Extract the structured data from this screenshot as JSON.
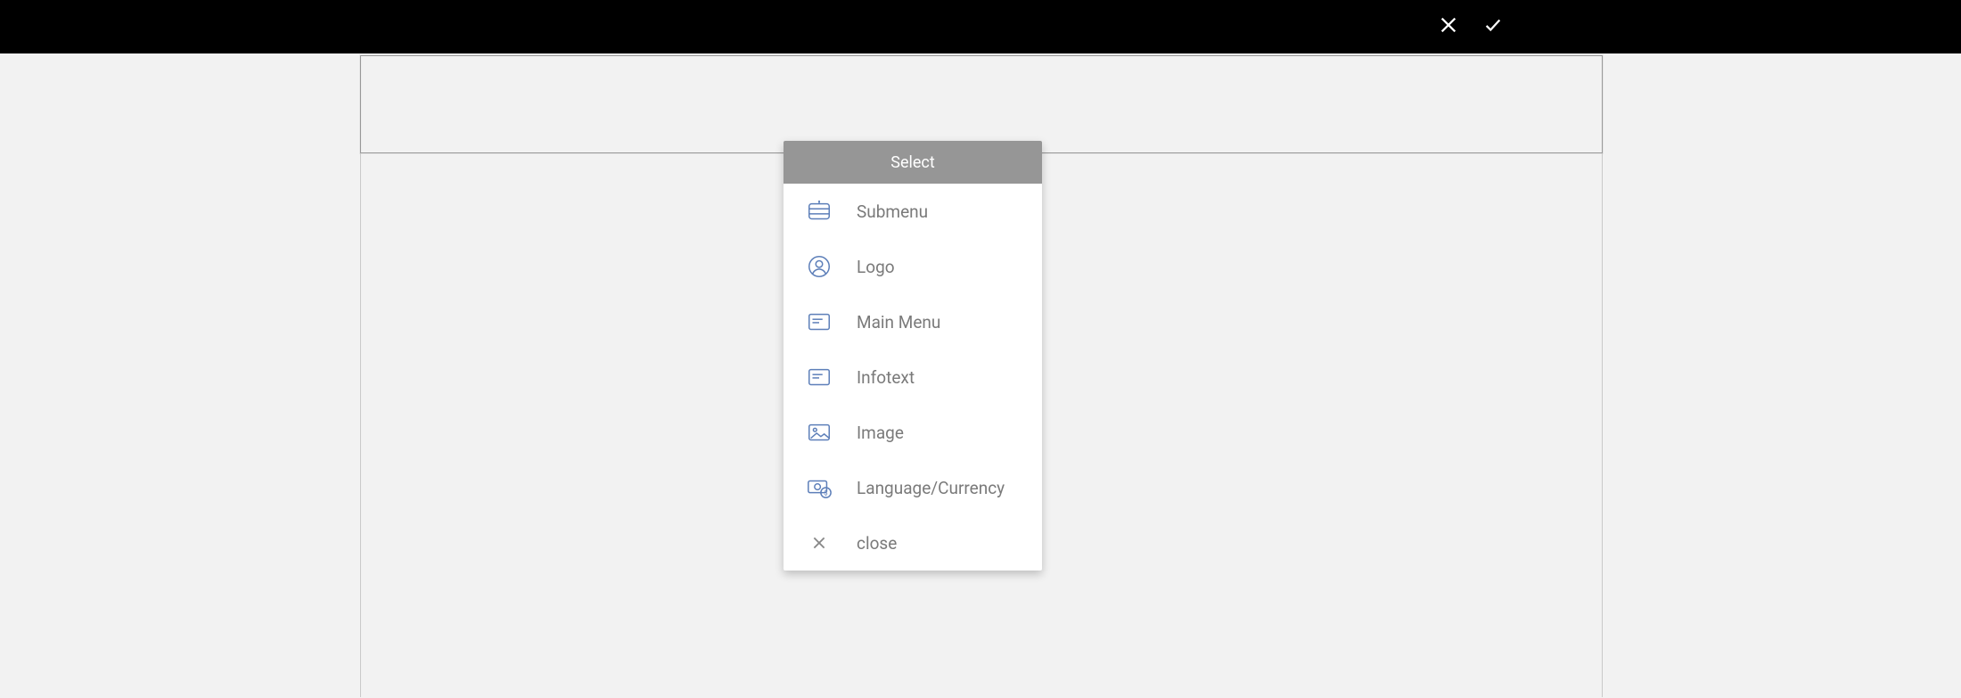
{
  "topbar": {
    "cancel_label": "Cancel",
    "confirm_label": "Confirm"
  },
  "dropdown": {
    "header": "Select",
    "items": [
      {
        "label": "Submenu"
      },
      {
        "label": "Logo"
      },
      {
        "label": "Main Menu"
      },
      {
        "label": "Infotext"
      },
      {
        "label": "Image"
      },
      {
        "label": "Language/Currency"
      },
      {
        "label": "close"
      }
    ]
  }
}
